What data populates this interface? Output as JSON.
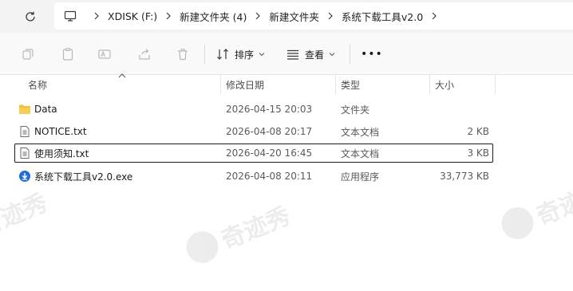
{
  "breadcrumb": {
    "items": [
      "XDISK (F:)",
      "新建文件夹 (4)",
      "新建文件夹",
      "系统下载工具v2.0"
    ]
  },
  "toolbar": {
    "sort_label": "排序",
    "view_label": "查看",
    "more_label": "•••"
  },
  "columns": {
    "name": "名称",
    "modified": "修改日期",
    "type": "类型",
    "size": "大小"
  },
  "files": [
    {
      "name": "Data",
      "modified": "2026-04-15 20:03",
      "type": "文件夹",
      "size": "",
      "icon": "folder-icon"
    },
    {
      "name": "NOTICE.txt",
      "modified": "2026-04-08 20:17",
      "type": "文本文档",
      "size": "2 KB",
      "icon": "text-file-icon"
    },
    {
      "name": "使用须知.txt",
      "modified": "2026-04-20 16:45",
      "type": "文本文档",
      "size": "3 KB",
      "icon": "text-file-icon",
      "selected": true
    },
    {
      "name": "系统下载工具v2.0.exe",
      "modified": "2026-04-08 20:11",
      "type": "应用程序",
      "size": "33,773 KB",
      "icon": "exe-app-icon"
    }
  ],
  "watermark": {
    "text": "奇迹秀"
  },
  "colors": {
    "folder": "#f5bf3a",
    "accent": "#1f6fd6",
    "selection_border": "#1a1a1a"
  }
}
